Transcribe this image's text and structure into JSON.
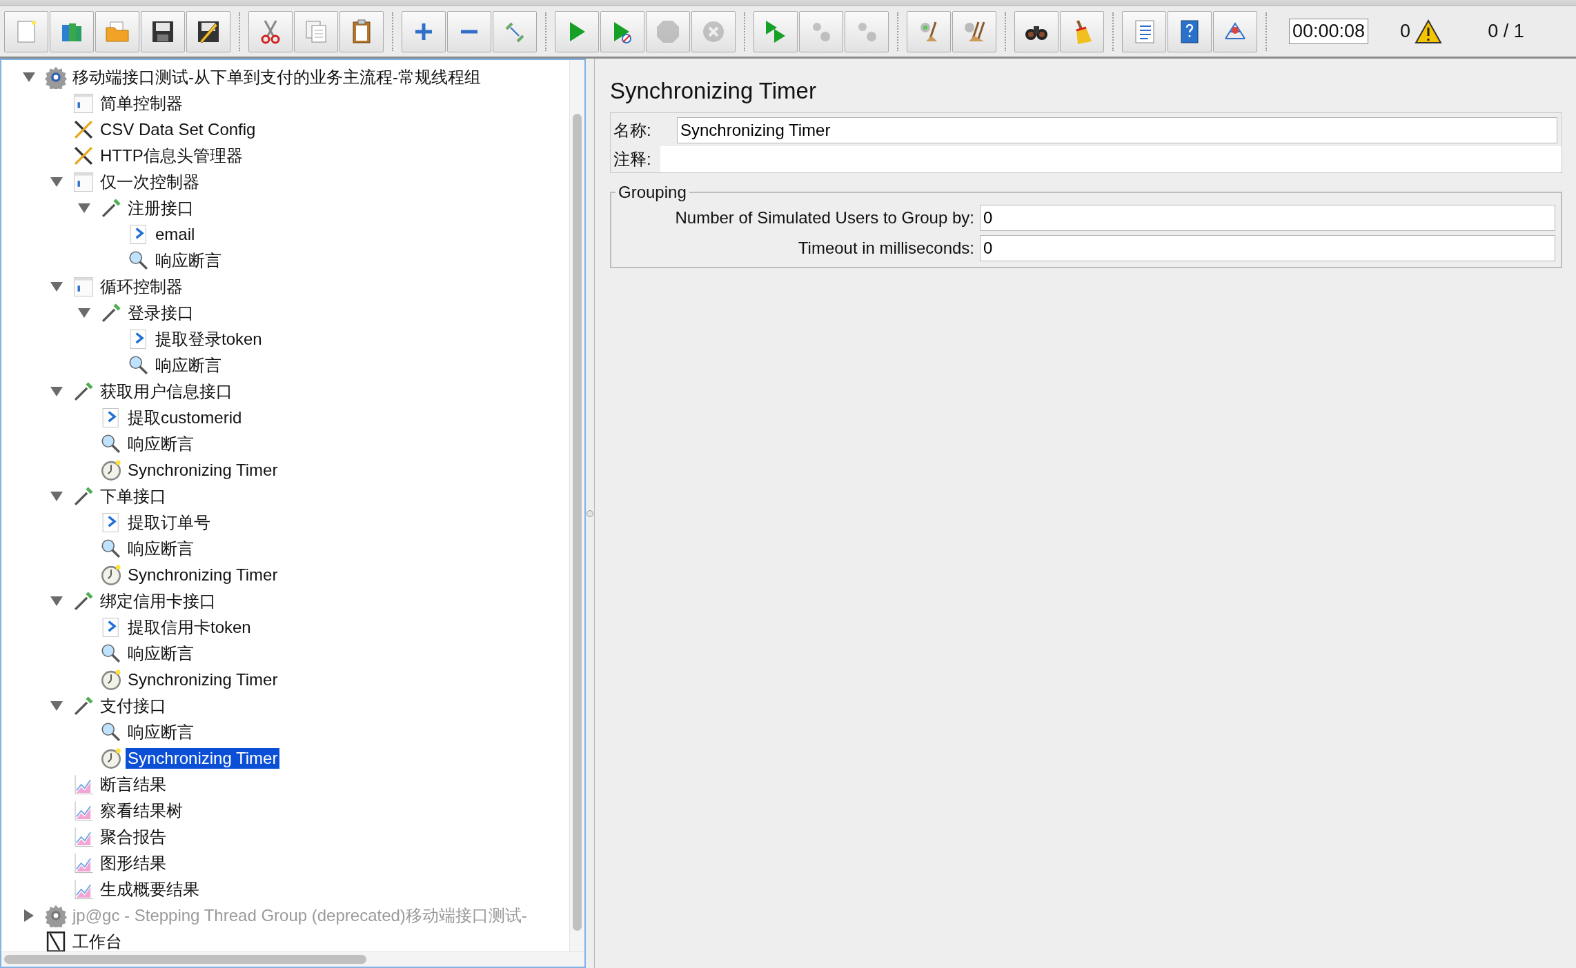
{
  "toolbar": {
    "groups": [
      [
        {
          "kind": "new",
          "disabled": false
        },
        {
          "kind": "templates",
          "disabled": false
        },
        {
          "kind": "open",
          "disabled": false
        },
        {
          "kind": "save",
          "disabled": false
        },
        {
          "kind": "save-as",
          "disabled": false
        }
      ],
      [
        {
          "kind": "cut",
          "disabled": false
        },
        {
          "kind": "copy",
          "disabled": false
        },
        {
          "kind": "paste",
          "disabled": false
        }
      ],
      [
        {
          "kind": "expand",
          "disabled": false
        },
        {
          "kind": "collapse",
          "disabled": false
        },
        {
          "kind": "toggle",
          "disabled": false
        }
      ],
      [
        {
          "kind": "start",
          "disabled": false
        },
        {
          "kind": "start-no-pause",
          "disabled": false
        },
        {
          "kind": "stop",
          "disabled": true
        },
        {
          "kind": "shutdown",
          "disabled": true
        }
      ],
      [
        {
          "kind": "remote-start",
          "disabled": false
        },
        {
          "kind": "remote-stop",
          "disabled": true
        },
        {
          "kind": "remote-exit",
          "disabled": true
        }
      ],
      [
        {
          "kind": "clear",
          "disabled": false
        },
        {
          "kind": "clear-all",
          "disabled": false
        }
      ],
      [
        {
          "kind": "search",
          "disabled": false
        },
        {
          "kind": "reset-search",
          "disabled": false
        }
      ],
      [
        {
          "kind": "functions",
          "disabled": false
        },
        {
          "kind": "help",
          "disabled": false
        },
        {
          "kind": "logger",
          "disabled": false
        }
      ]
    ],
    "elapsed": "00:00:08",
    "warnings": "0",
    "threads": "0 / 1"
  },
  "tree": [
    {
      "label": "移动端接口测试-从下单到支付的业务主流程-常规线程组",
      "kind": "thread-group",
      "expanded": true,
      "disabled": false,
      "selected": false,
      "children": [
        {
          "label": "简单控制器",
          "kind": "controller",
          "selected": false
        },
        {
          "label": "CSV Data Set Config",
          "kind": "config",
          "selected": false
        },
        {
          "label": "HTTP信息头管理器",
          "kind": "config",
          "selected": false
        },
        {
          "label": "仅一次控制器",
          "kind": "controller",
          "expanded": true,
          "selected": false,
          "children": [
            {
              "label": "注册接口",
              "kind": "sampler",
              "expanded": true,
              "selected": false,
              "children": [
                {
                  "label": "email",
                  "kind": "extractor",
                  "selected": false
                },
                {
                  "label": "响应断言",
                  "kind": "assertion",
                  "selected": false
                }
              ]
            }
          ]
        },
        {
          "label": "循环控制器",
          "kind": "controller",
          "expanded": true,
          "selected": false,
          "children": [
            {
              "label": "登录接口",
              "kind": "sampler",
              "expanded": true,
              "selected": false,
              "children": [
                {
                  "label": "提取登录token",
                  "kind": "extractor",
                  "selected": false
                },
                {
                  "label": "响应断言",
                  "kind": "assertion",
                  "selected": false
                }
              ]
            }
          ]
        },
        {
          "label": "获取用户信息接口",
          "kind": "sampler",
          "expanded": true,
          "selected": false,
          "children": [
            {
              "label": "提取customerid",
              "kind": "extractor",
              "selected": false
            },
            {
              "label": "响应断言",
              "kind": "assertion",
              "selected": false
            },
            {
              "label": "Synchronizing Timer",
              "kind": "timer",
              "selected": false
            }
          ]
        },
        {
          "label": "下单接口",
          "kind": "sampler",
          "expanded": true,
          "selected": false,
          "children": [
            {
              "label": "提取订单号",
              "kind": "extractor",
              "selected": false
            },
            {
              "label": "响应断言",
              "kind": "assertion",
              "selected": false
            },
            {
              "label": "Synchronizing Timer",
              "kind": "timer",
              "selected": false
            }
          ]
        },
        {
          "label": "绑定信用卡接口",
          "kind": "sampler",
          "expanded": true,
          "selected": false,
          "children": [
            {
              "label": "提取信用卡token",
              "kind": "extractor",
              "selected": false
            },
            {
              "label": "响应断言",
              "kind": "assertion",
              "selected": false
            },
            {
              "label": "Synchronizing Timer",
              "kind": "timer",
              "selected": false
            }
          ]
        },
        {
          "label": "支付接口",
          "kind": "sampler",
          "expanded": true,
          "selected": false,
          "children": [
            {
              "label": "响应断言",
              "kind": "assertion",
              "selected": false
            },
            {
              "label": "Synchronizing Timer",
              "kind": "timer",
              "selected": true
            }
          ]
        },
        {
          "label": "断言结果",
          "kind": "listener",
          "selected": false
        },
        {
          "label": "察看结果树",
          "kind": "listener",
          "selected": false
        },
        {
          "label": "聚合报告",
          "kind": "listener",
          "selected": false
        },
        {
          "label": "图形结果",
          "kind": "listener",
          "selected": false
        },
        {
          "label": "生成概要结果",
          "kind": "listener",
          "selected": false
        }
      ]
    },
    {
      "label": "jp@gc - Stepping Thread Group (deprecated)移动端接口测试-",
      "kind": "thread-group",
      "expanded": false,
      "disabled": true,
      "selected": false
    },
    {
      "label": "工作台",
      "kind": "workbench",
      "disabled": false,
      "selected": false
    }
  ],
  "editor": {
    "title": "Synchronizing Timer",
    "name_label": "名称:",
    "name_value": "Synchronizing Timer",
    "comment_label": "注释:",
    "group": {
      "legend": "Grouping",
      "fields": [
        {
          "label": "Number of Simulated Users to Group by:",
          "value": "0"
        },
        {
          "label": "Timeout in milliseconds:",
          "value": "0"
        }
      ]
    }
  }
}
